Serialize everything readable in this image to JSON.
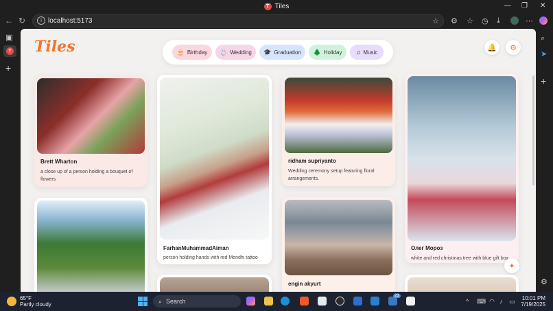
{
  "browser": {
    "tab_title": "Tiles",
    "tab_favicon_letter": "T",
    "url": "localhost:5173",
    "minimize": "—",
    "maximize": "❐",
    "close": "✕"
  },
  "app": {
    "logo": "Tiles",
    "categories": [
      {
        "label": "Birthday",
        "icon": "cake-icon",
        "glyph": "🎂",
        "color": "#fbd7df"
      },
      {
        "label": "Wedding",
        "icon": "ring-icon",
        "glyph": "💍",
        "color": "#f6d6e6"
      },
      {
        "label": "Graduation",
        "icon": "graduation-cap-icon",
        "glyph": "🎓",
        "color": "#d5e5fb"
      },
      {
        "label": "Holiday",
        "icon": "tree-icon",
        "glyph": "🌲",
        "color": "#d2f1dd"
      },
      {
        "label": "Music",
        "icon": "music-note-icon",
        "glyph": "♫",
        "color": "#e7dcfb"
      }
    ],
    "cards": [
      {
        "author": "Brett Wharton",
        "description": "a close up of a person holding a bouquet of flowers",
        "bg": "#fbe9e6"
      },
      {
        "author": "FarhanMuhammadAiman",
        "description": "person holding hands with red Mendhi tattoo",
        "bg": "#ffffff"
      },
      {
        "author": "ridham supriyanto",
        "description": "Wedding ceremony setup featuring floral arrangements.",
        "bg": "#fbeee9"
      },
      {
        "author": "Олег Мороз",
        "description": "white and red christmas tree with blue gift box",
        "bg": "#fbeff1"
      },
      {
        "author": "engin akyurt",
        "description": "",
        "bg": "#fdf0ea"
      },
      {
        "author": "",
        "description": "",
        "bg": "#ffffff"
      },
      {
        "author": "",
        "description": "",
        "bg": "#ffffff"
      },
      {
        "author": "",
        "description": "",
        "bg": "#ffffff"
      }
    ]
  },
  "taskbar": {
    "temperature": "65°F",
    "weather": "Partly cloudy",
    "search_label": "Search",
    "time": "10:01 PM",
    "date": "7/19/2025",
    "badge": "23"
  }
}
